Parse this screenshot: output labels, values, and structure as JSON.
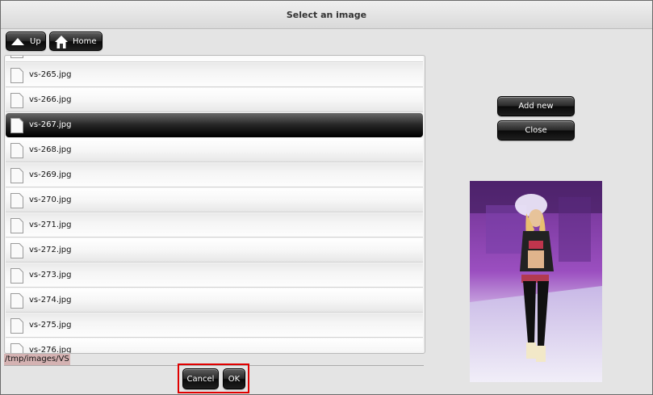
{
  "dialog": {
    "title": "Select an image"
  },
  "nav": {
    "up_label": "Up",
    "home_label": "Home"
  },
  "files": [
    "vs-265.jpg",
    "vs-266.jpg",
    "vs-267.jpg",
    "vs-268.jpg",
    "vs-269.jpg",
    "vs-270.jpg",
    "vs-271.jpg",
    "vs-272.jpg",
    "vs-273.jpg",
    "vs-274.jpg",
    "vs-275.jpg",
    "vs-276.jpg"
  ],
  "selected_file": "vs-267.jpg",
  "current_path": "/tmp/images/VS",
  "actions": {
    "add_new_label": "Add new",
    "close_label": "Close",
    "cancel_label": "Cancel",
    "ok_label": "OK"
  },
  "colors": {
    "focus_outline": "#e00000",
    "path_highlight": "#d4b2b2",
    "button_dark": "#1a1a1a"
  },
  "icons": {
    "up": "up-arrow-icon",
    "home": "home-icon",
    "file": "file-icon"
  }
}
